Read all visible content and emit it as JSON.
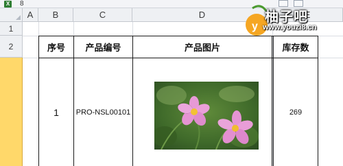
{
  "window": {
    "title_number": "8",
    "app_icon": "excel-icon"
  },
  "columns": [
    "A",
    "B",
    "C",
    "D",
    "E"
  ],
  "rows": [
    "1",
    "2"
  ],
  "table": {
    "headers": [
      "序号",
      "产品编号",
      "产品图片",
      "库存数"
    ],
    "row": {
      "index": "1",
      "product_code": "PRO-NSL00101",
      "product_image": "pink-cosmos-flowers-photo",
      "stock": "269"
    }
  },
  "watermark": {
    "brand": "柚子吧",
    "url": "www.youzi8.cn"
  },
  "colors": {
    "header_fill": "#eef0f3",
    "selected_row_header": "#ffd86a",
    "gridline": "#dadde2",
    "border": "#1a1a1a"
  }
}
